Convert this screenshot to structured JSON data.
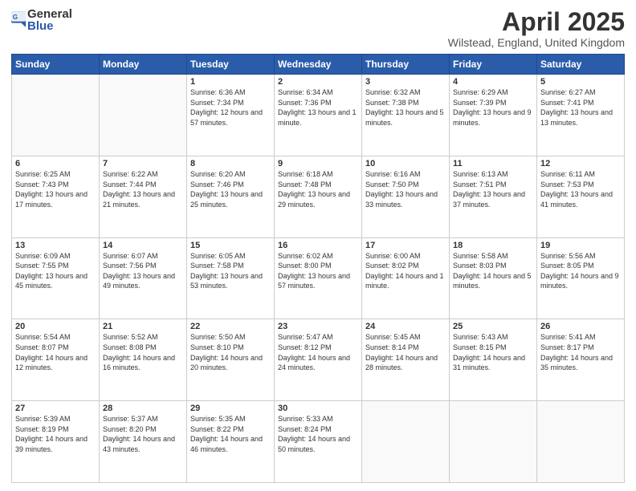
{
  "logo": {
    "general": "General",
    "blue": "Blue"
  },
  "title": "April 2025",
  "location": "Wilstead, England, United Kingdom",
  "days_of_week": [
    "Sunday",
    "Monday",
    "Tuesday",
    "Wednesday",
    "Thursday",
    "Friday",
    "Saturday"
  ],
  "weeks": [
    [
      {
        "day": "",
        "sunrise": "",
        "sunset": "",
        "daylight": ""
      },
      {
        "day": "",
        "sunrise": "",
        "sunset": "",
        "daylight": ""
      },
      {
        "day": "1",
        "sunrise": "Sunrise: 6:36 AM",
        "sunset": "Sunset: 7:34 PM",
        "daylight": "Daylight: 12 hours and 57 minutes."
      },
      {
        "day": "2",
        "sunrise": "Sunrise: 6:34 AM",
        "sunset": "Sunset: 7:36 PM",
        "daylight": "Daylight: 13 hours and 1 minute."
      },
      {
        "day": "3",
        "sunrise": "Sunrise: 6:32 AM",
        "sunset": "Sunset: 7:38 PM",
        "daylight": "Daylight: 13 hours and 5 minutes."
      },
      {
        "day": "4",
        "sunrise": "Sunrise: 6:29 AM",
        "sunset": "Sunset: 7:39 PM",
        "daylight": "Daylight: 13 hours and 9 minutes."
      },
      {
        "day": "5",
        "sunrise": "Sunrise: 6:27 AM",
        "sunset": "Sunset: 7:41 PM",
        "daylight": "Daylight: 13 hours and 13 minutes."
      }
    ],
    [
      {
        "day": "6",
        "sunrise": "Sunrise: 6:25 AM",
        "sunset": "Sunset: 7:43 PM",
        "daylight": "Daylight: 13 hours and 17 minutes."
      },
      {
        "day": "7",
        "sunrise": "Sunrise: 6:22 AM",
        "sunset": "Sunset: 7:44 PM",
        "daylight": "Daylight: 13 hours and 21 minutes."
      },
      {
        "day": "8",
        "sunrise": "Sunrise: 6:20 AM",
        "sunset": "Sunset: 7:46 PM",
        "daylight": "Daylight: 13 hours and 25 minutes."
      },
      {
        "day": "9",
        "sunrise": "Sunrise: 6:18 AM",
        "sunset": "Sunset: 7:48 PM",
        "daylight": "Daylight: 13 hours and 29 minutes."
      },
      {
        "day": "10",
        "sunrise": "Sunrise: 6:16 AM",
        "sunset": "Sunset: 7:50 PM",
        "daylight": "Daylight: 13 hours and 33 minutes."
      },
      {
        "day": "11",
        "sunrise": "Sunrise: 6:13 AM",
        "sunset": "Sunset: 7:51 PM",
        "daylight": "Daylight: 13 hours and 37 minutes."
      },
      {
        "day": "12",
        "sunrise": "Sunrise: 6:11 AM",
        "sunset": "Sunset: 7:53 PM",
        "daylight": "Daylight: 13 hours and 41 minutes."
      }
    ],
    [
      {
        "day": "13",
        "sunrise": "Sunrise: 6:09 AM",
        "sunset": "Sunset: 7:55 PM",
        "daylight": "Daylight: 13 hours and 45 minutes."
      },
      {
        "day": "14",
        "sunrise": "Sunrise: 6:07 AM",
        "sunset": "Sunset: 7:56 PM",
        "daylight": "Daylight: 13 hours and 49 minutes."
      },
      {
        "day": "15",
        "sunrise": "Sunrise: 6:05 AM",
        "sunset": "Sunset: 7:58 PM",
        "daylight": "Daylight: 13 hours and 53 minutes."
      },
      {
        "day": "16",
        "sunrise": "Sunrise: 6:02 AM",
        "sunset": "Sunset: 8:00 PM",
        "daylight": "Daylight: 13 hours and 57 minutes."
      },
      {
        "day": "17",
        "sunrise": "Sunrise: 6:00 AM",
        "sunset": "Sunset: 8:02 PM",
        "daylight": "Daylight: 14 hours and 1 minute."
      },
      {
        "day": "18",
        "sunrise": "Sunrise: 5:58 AM",
        "sunset": "Sunset: 8:03 PM",
        "daylight": "Daylight: 14 hours and 5 minutes."
      },
      {
        "day": "19",
        "sunrise": "Sunrise: 5:56 AM",
        "sunset": "Sunset: 8:05 PM",
        "daylight": "Daylight: 14 hours and 9 minutes."
      }
    ],
    [
      {
        "day": "20",
        "sunrise": "Sunrise: 5:54 AM",
        "sunset": "Sunset: 8:07 PM",
        "daylight": "Daylight: 14 hours and 12 minutes."
      },
      {
        "day": "21",
        "sunrise": "Sunrise: 5:52 AM",
        "sunset": "Sunset: 8:08 PM",
        "daylight": "Daylight: 14 hours and 16 minutes."
      },
      {
        "day": "22",
        "sunrise": "Sunrise: 5:50 AM",
        "sunset": "Sunset: 8:10 PM",
        "daylight": "Daylight: 14 hours and 20 minutes."
      },
      {
        "day": "23",
        "sunrise": "Sunrise: 5:47 AM",
        "sunset": "Sunset: 8:12 PM",
        "daylight": "Daylight: 14 hours and 24 minutes."
      },
      {
        "day": "24",
        "sunrise": "Sunrise: 5:45 AM",
        "sunset": "Sunset: 8:14 PM",
        "daylight": "Daylight: 14 hours and 28 minutes."
      },
      {
        "day": "25",
        "sunrise": "Sunrise: 5:43 AM",
        "sunset": "Sunset: 8:15 PM",
        "daylight": "Daylight: 14 hours and 31 minutes."
      },
      {
        "day": "26",
        "sunrise": "Sunrise: 5:41 AM",
        "sunset": "Sunset: 8:17 PM",
        "daylight": "Daylight: 14 hours and 35 minutes."
      }
    ],
    [
      {
        "day": "27",
        "sunrise": "Sunrise: 5:39 AM",
        "sunset": "Sunset: 8:19 PM",
        "daylight": "Daylight: 14 hours and 39 minutes."
      },
      {
        "day": "28",
        "sunrise": "Sunrise: 5:37 AM",
        "sunset": "Sunset: 8:20 PM",
        "daylight": "Daylight: 14 hours and 43 minutes."
      },
      {
        "day": "29",
        "sunrise": "Sunrise: 5:35 AM",
        "sunset": "Sunset: 8:22 PM",
        "daylight": "Daylight: 14 hours and 46 minutes."
      },
      {
        "day": "30",
        "sunrise": "Sunrise: 5:33 AM",
        "sunset": "Sunset: 8:24 PM",
        "daylight": "Daylight: 14 hours and 50 minutes."
      },
      {
        "day": "",
        "sunrise": "",
        "sunset": "",
        "daylight": ""
      },
      {
        "day": "",
        "sunrise": "",
        "sunset": "",
        "daylight": ""
      },
      {
        "day": "",
        "sunrise": "",
        "sunset": "",
        "daylight": ""
      }
    ]
  ]
}
